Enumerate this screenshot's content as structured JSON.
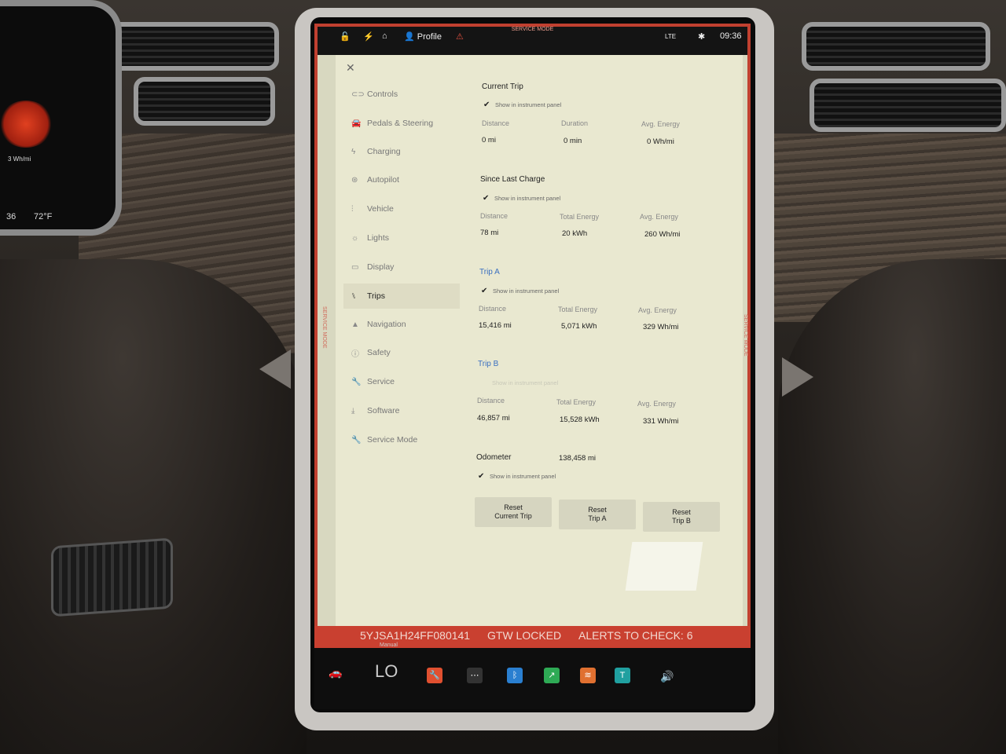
{
  "topbar": {
    "service_mode": "SERVICE MODE",
    "profile": "Profile",
    "network": "LTE",
    "time": "09:36"
  },
  "cluster": {
    "whmi": "3 Wh/mi",
    "odo": "36",
    "temp": "72°F"
  },
  "nav": {
    "items": [
      {
        "label": "Controls",
        "icon": "toggle-icon"
      },
      {
        "label": "Pedals & Steering",
        "icon": "car-icon"
      },
      {
        "label": "Charging",
        "icon": "bolt-icon"
      },
      {
        "label": "Autopilot",
        "icon": "steering-wheel-icon"
      },
      {
        "label": "Vehicle",
        "icon": "sliders-icon"
      },
      {
        "label": "Lights",
        "icon": "sun-icon"
      },
      {
        "label": "Display",
        "icon": "display-icon"
      },
      {
        "label": "Trips",
        "icon": "trips-icon"
      },
      {
        "label": "Navigation",
        "icon": "navigation-arrow-icon"
      },
      {
        "label": "Safety",
        "icon": "safety-icon"
      },
      {
        "label": "Service",
        "icon": "wrench-icon"
      },
      {
        "label": "Software",
        "icon": "download-icon"
      },
      {
        "label": "Service Mode",
        "icon": "wrench-icon"
      }
    ],
    "active": "Trips"
  },
  "trips": {
    "current": {
      "title": "Current Trip",
      "show": "Show in instrument panel",
      "labels": [
        "Distance",
        "Duration",
        "Avg. Energy"
      ],
      "values": [
        "0  mi",
        "0  min",
        "0  Wh/mi"
      ]
    },
    "since_charge": {
      "title": "Since Last Charge",
      "show": "Show in instrument panel",
      "labels": [
        "Distance",
        "Total Energy",
        "Avg. Energy"
      ],
      "values": [
        "78  mi",
        "20  kWh",
        "260  Wh/mi"
      ]
    },
    "trip_a": {
      "title": "Trip A",
      "show": "Show in instrument panel",
      "labels": [
        "Distance",
        "Total Energy",
        "Avg. Energy"
      ],
      "values": [
        "15,416  mi",
        "5,071  kWh",
        "329  Wh/mi"
      ]
    },
    "trip_b": {
      "title": "Trip B",
      "show": "Show in instrument panel",
      "labels": [
        "Distance",
        "Total Energy",
        "Avg. Energy"
      ],
      "values": [
        "46,857  mi",
        "15,528  kWh",
        "331  Wh/mi"
      ]
    },
    "odometer": {
      "label": "Odometer",
      "value": "138,458  mi",
      "show": "Show in instrument panel"
    },
    "buttons": {
      "reset_current": "Reset\nCurrent Trip",
      "reset_a": "Reset\nTrip A",
      "reset_b": "Reset\nTrip B"
    }
  },
  "alert": {
    "vin": "5YJSA1H24FF080141",
    "gtw": "GTW LOCKED",
    "alerts": "ALERTS TO CHECK: 6"
  },
  "dock": {
    "climate": "LO",
    "climate_mode": "Manual"
  },
  "colors": {
    "service_red": "#c94030",
    "link_blue": "#3a6fc0"
  }
}
